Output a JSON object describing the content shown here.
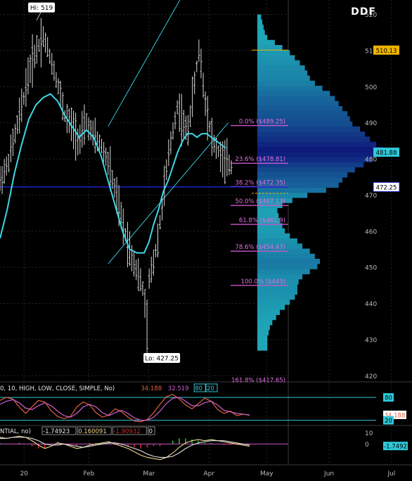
{
  "app": {
    "logo": "DDF"
  },
  "colors": {
    "background": "#000000",
    "grid": "#262626",
    "bars": "#d8d8d8",
    "moving_average": "#3fd6e6",
    "channel": "#35c8dc",
    "fib": "#cc55cc",
    "fib_text": "#e070e0",
    "current_price_line": "#1a24c8",
    "poc_line": "#f0b400",
    "volume_profile_low": "#1fa8b8",
    "volume_profile_high": "#0e1a7a",
    "stoch_k": "#e06040",
    "stoch_d": "#d060d0",
    "macd_line": "#f0d890",
    "macd_signal": "#e0e0e0",
    "hist_pos": "#30c030",
    "hist_neg": "#d03030"
  },
  "chart_data": [
    {
      "type": "ohlc",
      "title": "",
      "xlabel": "",
      "ylabel": "",
      "x_ticks": [
        "20",
        "Feb",
        "Mar",
        "Apr",
        "May",
        "Jun",
        "Jul"
      ],
      "y_ticks": [
        420,
        430,
        440,
        450,
        460,
        470,
        480,
        490,
        500,
        510,
        520
      ],
      "ylim": [
        418.5,
        524
      ],
      "grid": true,
      "annotations": {
        "high": "Hi: 519",
        "low": "Lo: 427.25"
      },
      "series": [
        {
          "kind": "price",
          "points": [
            [
              0,
              474
            ],
            [
              3,
              478
            ],
            [
              6,
              486
            ],
            [
              9,
              494
            ],
            [
              12,
              504
            ],
            [
              15,
              510
            ],
            [
              18,
              514
            ],
            [
              21,
              508
            ],
            [
              24,
              501
            ],
            [
              27,
              492
            ],
            [
              30,
              489
            ],
            [
              33,
              485
            ],
            [
              36,
              490
            ],
            [
              39,
              486
            ],
            [
              42,
              484
            ],
            [
              45,
              479
            ],
            [
              48,
              471
            ],
            [
              51,
              462
            ],
            [
              54,
              455
            ],
            [
              57,
              449
            ],
            [
              60,
              443
            ],
            [
              61,
              432
            ],
            [
              62,
              446
            ],
            [
              64,
              452
            ],
            [
              66,
              459
            ],
            [
              68,
              470
            ],
            [
              70,
              480
            ],
            [
              72,
              488
            ],
            [
              74,
              495
            ],
            [
              76,
              490
            ],
            [
              78,
              487
            ],
            [
              80,
              496
            ],
            [
              82,
              506
            ],
            [
              83,
              511
            ],
            [
              85,
              498
            ],
            [
              87,
              490
            ],
            [
              89,
              484
            ],
            [
              91,
              482
            ],
            [
              93,
              479
            ],
            [
              95,
              479
            ],
            [
              97,
              477
            ]
          ]
        },
        {
          "kind": "moving_average",
          "points": [
            [
              0,
              458
            ],
            [
              3,
              466
            ],
            [
              6,
              476
            ],
            [
              9,
              484
            ],
            [
              12,
              491
            ],
            [
              15,
              495
            ],
            [
              18,
              497
            ],
            [
              21,
              498
            ],
            [
              24,
              496
            ],
            [
              27,
              492
            ],
            [
              30,
              489
            ],
            [
              33,
              486
            ],
            [
              36,
              488
            ],
            [
              39,
              486
            ],
            [
              42,
              481
            ],
            [
              45,
              474
            ],
            [
              48,
              467
            ],
            [
              51,
              460
            ],
            [
              54,
              455
            ],
            [
              57,
              454
            ],
            [
              60,
              454
            ],
            [
              62,
              457
            ],
            [
              64,
              462
            ],
            [
              66,
              466
            ],
            [
              68,
              471
            ],
            [
              70,
              474
            ],
            [
              72,
              478
            ],
            [
              74,
              482
            ],
            [
              76,
              485
            ],
            [
              78,
              487
            ],
            [
              80,
              487
            ],
            [
              82,
              486
            ],
            [
              84,
              487
            ],
            [
              86,
              487
            ],
            [
              88,
              486
            ],
            [
              90,
              485
            ],
            [
              92,
              484
            ],
            [
              94,
              483
            ]
          ]
        }
      ],
      "channel": {
        "upper": [
          [
            45,
            489
          ],
          [
            80,
            530
          ]
        ],
        "lower": [
          [
            45,
            451
          ],
          [
            95,
            490
          ]
        ]
      },
      "price_labels": [
        {
          "label": "510.13",
          "value": 510.13,
          "color": "#f0b400"
        },
        {
          "label": "481.88",
          "value": 481.88,
          "color": "#30c8d8"
        },
        {
          "label": "472.25",
          "value": 472.25,
          "color": "#1a24c8"
        }
      ],
      "fib_levels": [
        {
          "label": "0.0% ($489.25)",
          "value": 489.25
        },
        {
          "label": "23.6% ($478.81)",
          "value": 478.81
        },
        {
          "label": "38.2% ($472.35)",
          "value": 472.35
        },
        {
          "label": "50.0% ($467.13)",
          "value": 467.13
        },
        {
          "label": "61.8% ($461.9)",
          "value": 461.9
        },
        {
          "label": "78.6% ($454.47)",
          "value": 454.47
        },
        {
          "label": "100.0% ($445)",
          "value": 445
        },
        {
          "label": "161.8% ($417.65)",
          "value": 417.65
        }
      ],
      "volume_profile": {
        "price_range": [
          427,
          520
        ],
        "relative_volume": [
          0.08,
          0.08,
          0.08,
          0.09,
          0.1,
          0.12,
          0.15,
          0.18,
          0.22,
          0.26,
          0.3,
          0.32,
          0.32,
          0.33,
          0.36,
          0.42,
          0.48,
          0.5,
          0.46,
          0.42,
          0.36,
          0.32,
          0.26,
          0.22,
          0.2,
          0.18,
          0.17,
          0.16,
          0.2,
          0.28,
          0.4,
          0.55,
          0.65,
          0.68,
          0.72,
          0.78,
          0.85,
          0.92,
          0.98,
          1.0,
          0.95,
          0.9,
          0.86,
          0.82,
          0.76,
          0.74,
          0.72,
          0.68,
          0.65,
          0.62,
          0.58,
          0.52,
          0.46,
          0.42,
          0.4,
          0.38,
          0.34,
          0.3,
          0.26,
          0.2,
          0.14,
          0.08,
          0.06,
          0.05,
          0.04,
          0.03
        ]
      }
    },
    {
      "type": "line",
      "title": "",
      "header_parts": [
        {
          "text": "0, 10, HIGH, LOW, CLOSE, SIMPLE, No)",
          "color": "#e8e8e8"
        },
        {
          "text": "34.188",
          "color": "#e06040"
        },
        {
          "text": "32.519",
          "color": "#d060d0"
        },
        {
          "text": "80",
          "color": "#30c8d8"
        },
        {
          "text": "20",
          "color": "#30c8d8"
        }
      ],
      "ylim": [
        10,
        95
      ],
      "reference_lines": [
        80,
        20
      ],
      "right_labels": [
        {
          "label": "80",
          "value": 80,
          "color": "#30c8d8"
        },
        {
          "label": "34.188",
          "value": 34.188,
          "color": "#e06040"
        },
        {
          "label": "20",
          "value": 20,
          "color": "#30c8d8"
        }
      ],
      "series": [
        {
          "name": "34.188",
          "values": [
            72,
            80,
            76,
            55,
            38,
            55,
            72,
            68,
            45,
            30,
            24,
            30,
            55,
            68,
            60,
            40,
            28,
            34,
            50,
            42,
            28,
            18,
            16,
            22,
            40,
            62,
            82,
            88,
            76,
            60,
            50,
            64,
            78,
            70,
            48,
            38,
            44,
            32,
            36,
            34
          ]
        },
        {
          "name": "32.519",
          "values": [
            62,
            70,
            74,
            66,
            52,
            48,
            58,
            66,
            58,
            44,
            32,
            28,
            38,
            55,
            62,
            55,
            40,
            32,
            40,
            46,
            38,
            26,
            20,
            20,
            28,
            44,
            64,
            78,
            80,
            70,
            58,
            58,
            66,
            70,
            60,
            46,
            42,
            38,
            36,
            33
          ]
        }
      ]
    },
    {
      "type": "bar",
      "title": "",
      "header_parts": [
        {
          "text": "NTIAL, no)",
          "color": "#e8e8e8"
        },
        {
          "text": "-1.74923",
          "color": "#e8e8e8"
        },
        {
          "text": "0.160091",
          "color": "#f0d890"
        },
        {
          "text": "-1.90932",
          "color": "#d03030"
        },
        {
          "text": "0",
          "color": "#e8e8e8"
        }
      ],
      "y_ticks": [
        10,
        0
      ],
      "ylim": [
        -18,
        16
      ],
      "right_labels": [
        {
          "label": "-1.7492",
          "value": -1.7492,
          "color": "#30c8d8"
        }
      ],
      "series": [
        {
          "name": "macd",
          "values": [
            6,
            5,
            6,
            7,
            6,
            3,
            -1,
            -4,
            -2,
            1,
            0,
            -2,
            -4,
            -3,
            -1,
            0,
            1,
            2,
            0,
            -2,
            -4,
            -7,
            -10,
            -12,
            -13,
            -14,
            -12,
            -8,
            -3,
            1,
            3,
            4,
            3,
            4,
            3,
            2,
            1,
            0,
            -1,
            -2
          ]
        },
        {
          "name": "signal",
          "values": [
            5,
            5,
            6,
            6,
            6,
            5,
            3,
            0,
            -1,
            -1,
            0,
            -1,
            -2,
            -3,
            -2,
            -1,
            0,
            1,
            1,
            0,
            -2,
            -4,
            -6,
            -9,
            -11,
            -12,
            -12,
            -11,
            -8,
            -4,
            -1,
            1,
            2,
            3,
            3,
            3,
            2,
            1,
            0,
            -1
          ]
        },
        {
          "name": "histogram",
          "values": [
            1,
            0,
            0,
            1,
            0,
            -2,
            -4,
            -4,
            -1,
            2,
            0,
            -1,
            -2,
            0,
            1,
            1,
            1,
            1,
            -1,
            -2,
            -2,
            -3,
            -4,
            -3,
            -2,
            -2,
            0,
            3,
            5,
            5,
            4,
            3,
            1,
            1,
            0,
            -1,
            -1,
            -1,
            -1,
            -1
          ]
        }
      ]
    }
  ]
}
